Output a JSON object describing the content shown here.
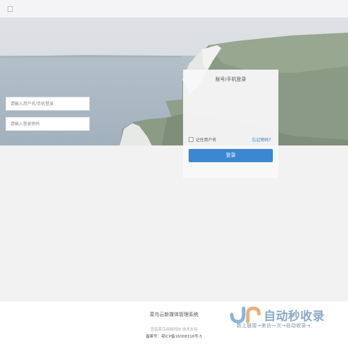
{
  "login": {
    "title": "账号/手机登录",
    "username_placeholder": "请输入用户名/手机登录",
    "password_placeholder": "请输入登录密码",
    "remember_label": "记住用户名",
    "forgot_label": "忘记密码？",
    "submit_label": "登录"
  },
  "footer": {
    "title": "菜鸟云新媒体管理系统",
    "support": "宜昌菜鸟网络科技 技术支持",
    "icp": "备案号：鄂ICP备16008316号-5"
  },
  "watermark": {
    "brand": "自动秒收录",
    "slogan": "数上链接→来访一次→自动收录→"
  },
  "colors": {
    "accent": "#3b87d1",
    "link": "#2f7fc1"
  }
}
